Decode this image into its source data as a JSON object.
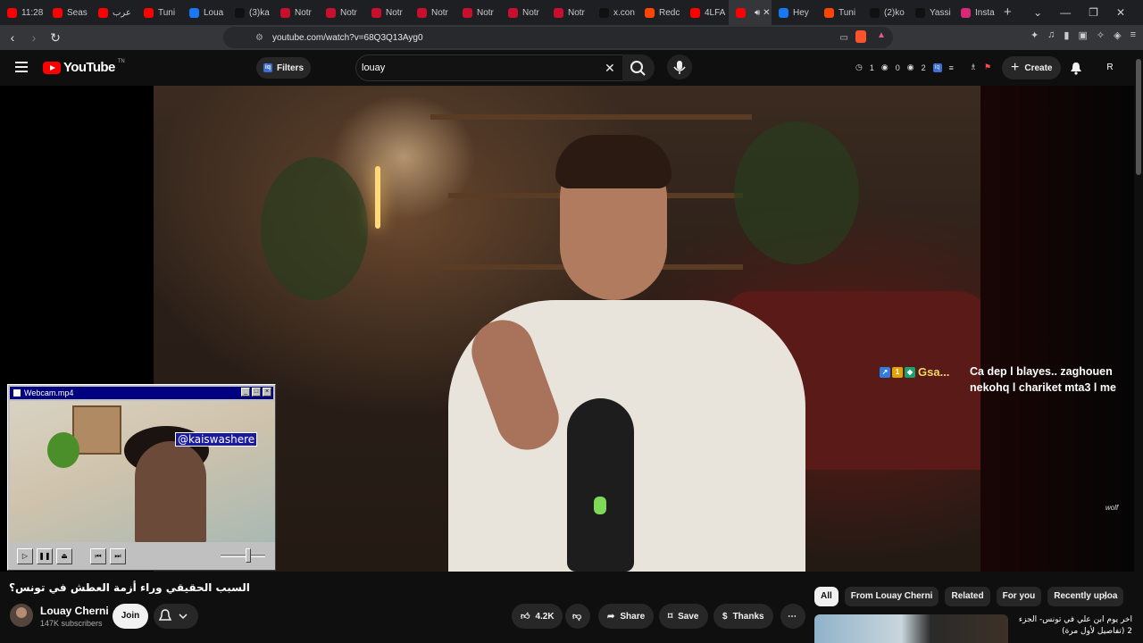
{
  "browser": {
    "tabs": [
      {
        "label": "11:28",
        "icon": "youtube-icon",
        "color": "#ff0000"
      },
      {
        "label": "Seas",
        "icon": "youtube-icon",
        "color": "#ff0000"
      },
      {
        "label": "عرب",
        "icon": "youtube-icon",
        "color": "#ff0000"
      },
      {
        "label": "Tuni",
        "icon": "youtube-icon",
        "color": "#ff0000"
      },
      {
        "label": "Loua",
        "icon": "facebook-icon",
        "color": "#1877f2"
      },
      {
        "label": "(3)ka",
        "icon": "tiktok-icon",
        "color": "#111111"
      },
      {
        "label": "Notr",
        "icon": "n-icon",
        "color": "#c8102e"
      },
      {
        "label": "Notr",
        "icon": "n-icon",
        "color": "#c8102e"
      },
      {
        "label": "Notr",
        "icon": "n-icon",
        "color": "#c8102e"
      },
      {
        "label": "Notr",
        "icon": "n-icon",
        "color": "#c8102e"
      },
      {
        "label": "Notr",
        "icon": "n-icon",
        "color": "#c8102e"
      },
      {
        "label": "Notr",
        "icon": "n-icon",
        "color": "#c8102e"
      },
      {
        "label": "Notr",
        "icon": "n-icon",
        "color": "#c8102e"
      },
      {
        "label": "x.con",
        "icon": "x-icon",
        "color": "#111111"
      },
      {
        "label": "Redc",
        "icon": "reddit-icon",
        "color": "#ff4500"
      },
      {
        "label": "4LFA",
        "icon": "youtube-icon",
        "color": "#ff0000"
      },
      {
        "label": "",
        "icon": "youtube-icon",
        "color": "#ff0000",
        "active": true
      },
      {
        "label": "Hey",
        "icon": "facebook-icon",
        "color": "#1877f2"
      },
      {
        "label": "Tuni",
        "icon": "reddit-icon",
        "color": "#ff4500"
      },
      {
        "label": "(2)ko",
        "icon": "tiktok-icon",
        "color": "#111111"
      },
      {
        "label": "Yassi",
        "icon": "tiktok-icon",
        "color": "#111111"
      },
      {
        "label": "Insta",
        "icon": "instagram-icon",
        "color": "#d62976"
      }
    ],
    "url": "youtube.com/watch?v=68Q3Q13Ayg0"
  },
  "youtube": {
    "logo_text": "YouTube",
    "logo_tm": "TN",
    "filters_label": "Filters",
    "search_value": "louay",
    "stats": {
      "a": "1",
      "b": "0",
      "c": "2"
    },
    "create_label": "Create",
    "avatar_letter": "R",
    "accent": "#ff0000"
  },
  "video": {
    "overlay_user": "Gsa...",
    "overlay_badge": "1",
    "overlay_message": "Ca dep l blayes.. zaghouen nekohq l chariket mta3 l me",
    "watermark": "wolf"
  },
  "webcam": {
    "title": "Webcam.mp4",
    "handle": "@kaiswashere"
  },
  "meta": {
    "title": "السبب الحقيقي وراء أزمة العطش في تونس؟",
    "channel_name": "Louay Cherni",
    "subscribers": "147K subscribers",
    "join_label": "Join",
    "likes": "4.2K",
    "share_label": "Share",
    "save_label": "Save",
    "thanks_label": "Thanks"
  },
  "chips": [
    "All",
    "From Louay Cherni",
    "Related",
    "For you",
    "Recently uploa"
  ],
  "recommendation": {
    "title": "اخر يوم ابن علي في تونس- الجزء 2 (تفاصيل لأول مرة)"
  }
}
